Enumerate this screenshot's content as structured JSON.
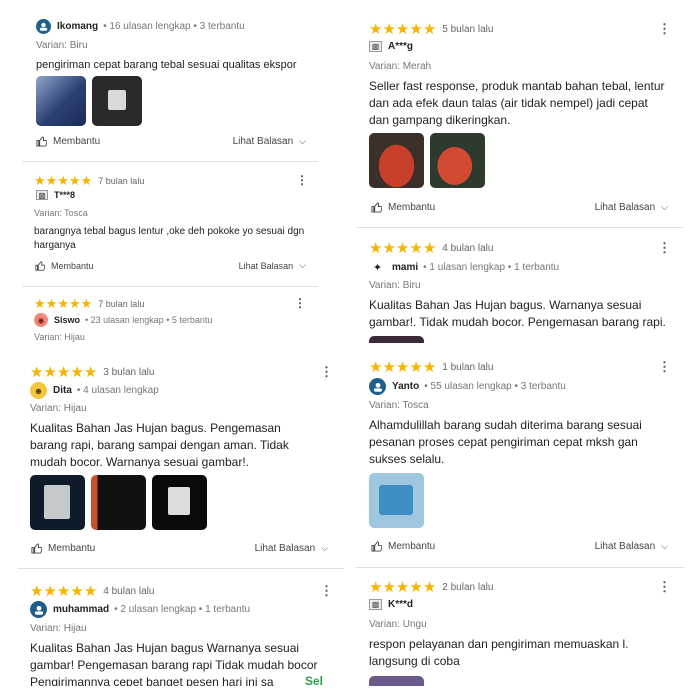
{
  "actions": {
    "helpful_label": "Membantu",
    "reply_label": "Lihat Balasan"
  },
  "colors": {
    "star": "#f5b400",
    "divider": "#e0e0e0",
    "see_more": "#2e9e4f"
  },
  "reviews": {
    "r1": {
      "user": "Ikomang",
      "meta": "• 16 ulasan lengkap • 3 terbantu",
      "variant": "Varian: Biru",
      "text": "pengiriman cepat barang tebal sesuai qualitas ekspor"
    },
    "r2": {
      "time": "7 bulan lalu",
      "user": "T***8",
      "variant": "Varian: Tosca",
      "text": "barangnya tebal bagus lentur ,oke deh pokoke yo sesuai dgn harganya"
    },
    "r3": {
      "time": "7 bulan lalu",
      "user": "Siswo",
      "meta": "• 23 ulasan lengkap • 5 terbantu",
      "variant": "Varian: Hijau"
    },
    "r4": {
      "time": "3 bulan lalu",
      "user": "Dita",
      "meta": "• 4 ulasan lengkap",
      "variant": "Varian: Hijau",
      "text": "Kualitas Bahan Jas Hujan bagus. Pengemasan barang rapi, barang sampai dengan aman. Tidak mudah bocor. Warnanya sesuai gambar!."
    },
    "r5": {
      "time": "4 bulan lalu",
      "user": "muhammad",
      "meta": "• 2 ulasan lengkap • 1 terbantu",
      "variant": "Varian: Hijau",
      "text": "Kualitas Bahan Jas Hujan bagus Warnanya sesuai gambar! Pengemasan barang rapi Tidak mudah bocor Pengirimannya cepet banget pesen hari ini sa",
      "more": "Sel"
    },
    "r6": {
      "time": "5 bulan lalu",
      "user": "A***g",
      "variant": "Varian: Merah",
      "text": "Seller fast response, produk mantab bahan tebal, lentur dan ada efek daun talas (air tidak nempel) jadi cepat dan gampang dikeringkan."
    },
    "r7": {
      "time": "4 bulan lalu",
      "user": "mami",
      "meta": "• 1 ulasan lengkap • 1 terbantu",
      "variant": "Varian: Biru",
      "text": "Kualitas Bahan Jas Hujan bagus. Warnanya sesuai gambar!. Tidak mudah bocor. Pengemasan barang rapi."
    },
    "r8": {
      "time": "1 bulan lalu",
      "user": "Yanto",
      "meta": "• 55 ulasan lengkap • 3 terbantu",
      "variant": "Varian: Tosca",
      "text": "Alhamdulillah barang sudah diterima barang sesuai pesanan proses cepat pengiriman cepat mksh gan sukses selalu."
    },
    "r9": {
      "time": "2 bulan lalu",
      "user": "K***d",
      "variant": "Varian: Ungu",
      "text": "respon pelayanan dan pengiriman memuaskan l. langsung di coba"
    }
  }
}
